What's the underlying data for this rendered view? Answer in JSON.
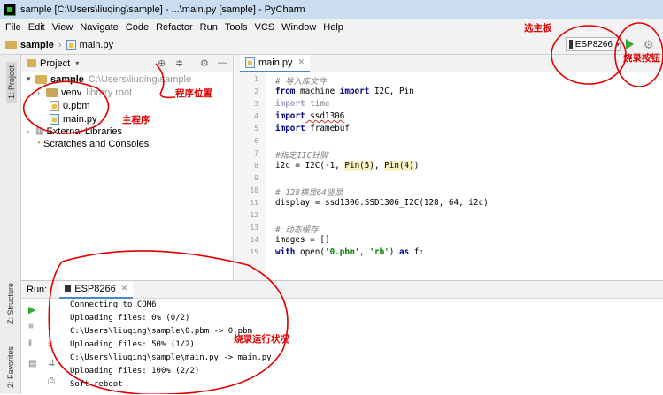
{
  "window": {
    "title": "sample [C:\\Users\\liuqing\\sample] - ...\\main.py [sample] - PyCharm"
  },
  "menu": [
    "File",
    "Edit",
    "View",
    "Navigate",
    "Code",
    "Refactor",
    "Run",
    "Tools",
    "VCS",
    "Window",
    "Help"
  ],
  "breadcrumb": {
    "project": "sample",
    "file": "main.py"
  },
  "run_config": {
    "device": "ESP8266"
  },
  "side_tabs": {
    "project": "1: Project",
    "structure": "Z: Structure",
    "favorites": "2: Favorites"
  },
  "project_panel": {
    "title": "Project",
    "root": "sample",
    "root_path": "C:\\Users\\liuqing\\sample",
    "items": [
      "venv",
      "library root",
      "0.pbm",
      "main.py",
      "External Libraries",
      "Scratches and Consoles"
    ]
  },
  "editor": {
    "tab": "main.py",
    "line_numbers": [
      "1",
      "2",
      "3",
      "4",
      "5",
      "6",
      "7",
      "8",
      "9",
      "10",
      "11",
      "12",
      "13",
      "14",
      "15"
    ],
    "lines": {
      "l1": "# 导入库文件",
      "l2_kw": "from",
      "l2a": " machine ",
      "l2_kw2": "import",
      "l2b": " I2C, Pin",
      "l3_kw": "import",
      "l3": " time",
      "l4_kw": "import",
      "l4": " ssd1306",
      "l5_kw": "import",
      "l5": " framebuf",
      "l7": "#指定IIC针脚",
      "l8a": "i2c = I2C(-1, ",
      "l8b": "Pin(5)",
      "l8c": ", ",
      "l8d": "Pin(4)",
      "l8e": ")",
      "l10": "# 128横显64竖显",
      "l11": "display = ssd1306.SSD1306_I2C(128, 64, i2c)",
      "l13": "# 动态缓存",
      "l14": "images = []",
      "l15_kw": "with",
      "l15a": " open(",
      "l15_s1": "'0.pbm'",
      "l15b": ", ",
      "l15_s2": "'rb'",
      "l15c": ") ",
      "l15_kw2": "as",
      "l15d": " f:"
    }
  },
  "run_panel": {
    "label": "Run:",
    "tab": "ESP8266",
    "output": [
      "Connecting to COM6",
      "Uploading files: 0% (0/2)",
      "C:\\Users\\liuqing\\sample\\0.pbm -> 0.pbm",
      "Uploading files: 50% (1/2)",
      "C:\\Users\\liuqing\\sample\\main.py -> main.py",
      "Uploading files: 100% (2/2)",
      "Soft reboot"
    ]
  },
  "annotations": {
    "select_board": "选主板",
    "flash_button": "烧录按钮",
    "program_location": "程序位置",
    "main_program": "主程序",
    "flash_status": "烧录运行状况"
  },
  "colors": {
    "annotation": "#e00000",
    "run_green": "#33aa33",
    "tab_underline": "#4a88c7"
  }
}
